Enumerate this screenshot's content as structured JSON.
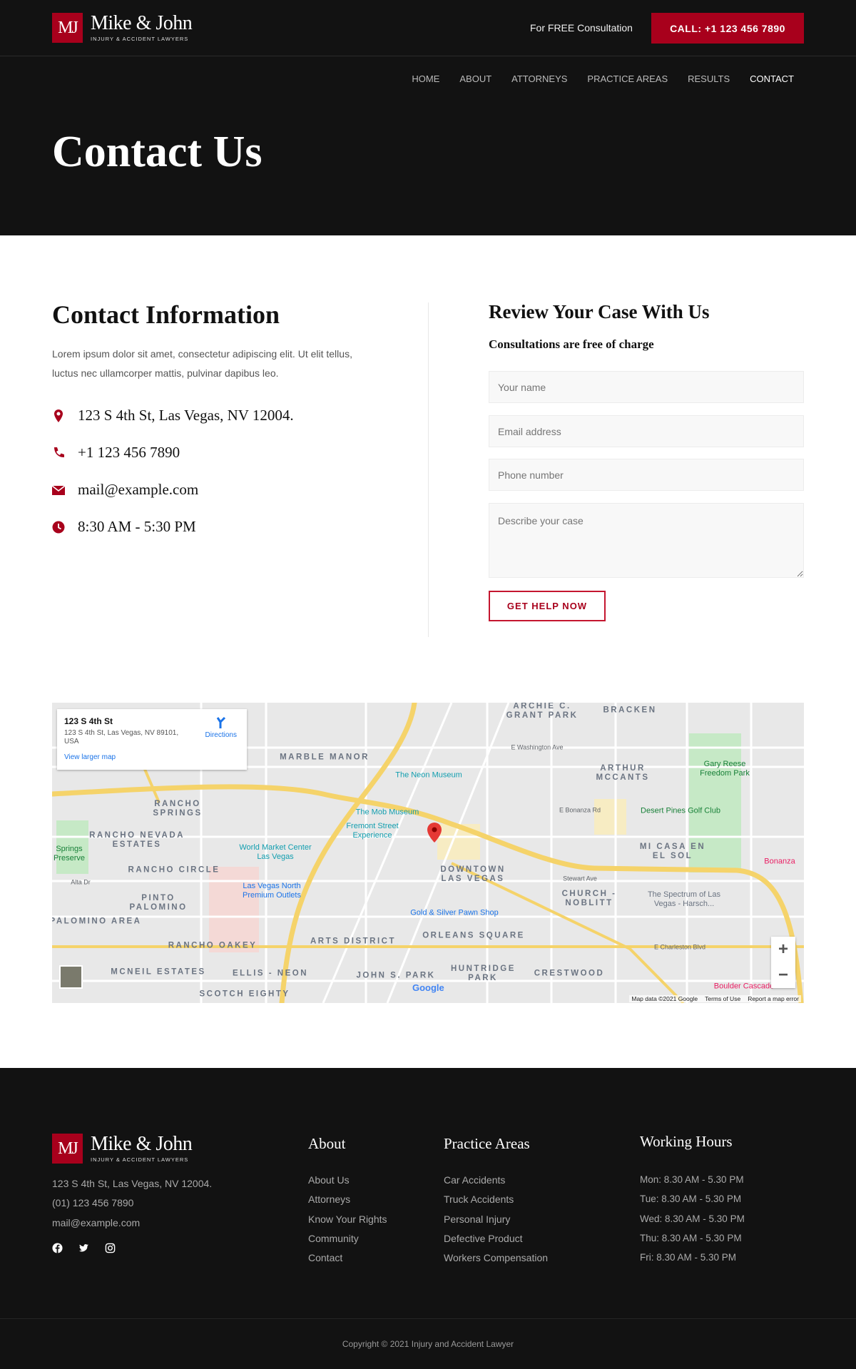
{
  "brand": {
    "mark": "MJ",
    "name": "Mike & John",
    "tagline": "INJURY & ACCIDENT LAWYERS",
    "accent": "#a8001c"
  },
  "header": {
    "free_text": "For FREE Consultation",
    "call_label": "CALL: +1 123 456 7890"
  },
  "nav": {
    "items": [
      {
        "label": "HOME"
      },
      {
        "label": "ABOUT"
      },
      {
        "label": "ATTORNEYS"
      },
      {
        "label": "PRACTICE AREAS"
      },
      {
        "label": "RESULTS"
      },
      {
        "label": "CONTACT",
        "active": true
      }
    ]
  },
  "hero": {
    "title": "Contact Us"
  },
  "contact": {
    "title": "Contact Information",
    "description": "Lorem ipsum dolor sit amet, consectetur adipiscing elit. Ut elit tellus, luctus nec ullamcorper mattis, pulvinar dapibus leo.",
    "items": [
      {
        "icon": "map-marker-icon",
        "text": "123 S 4th St, Las Vegas, NV 12004."
      },
      {
        "icon": "phone-icon",
        "text": "+1 123 456 7890"
      },
      {
        "icon": "envelope-icon",
        "text": "mail@example.com"
      },
      {
        "icon": "clock-icon",
        "text": "8:30 AM - 5:30 PM"
      }
    ]
  },
  "form": {
    "title": "Review Your Case With Us",
    "subtitle": "Consultations are free of charge",
    "name_placeholder": "Your name",
    "email_placeholder": "Email address",
    "phone_placeholder": "Phone number",
    "case_placeholder": "Describe your case",
    "submit_label": "GET HELP NOW"
  },
  "map": {
    "card": {
      "title": "123 S 4th St",
      "address": "123 S 4th St, Las Vegas, NV 89101, USA",
      "directions": "Directions",
      "larger": "View larger map"
    },
    "labels": [
      "ARCHIE C. GRANT PARK",
      "BRACKEN",
      "MARBLE MANOR",
      "The Neon Museum",
      "ARTHUR MCCANTS",
      "Gary Reese Freedom Park",
      "RANCHO SPRINGS",
      "The Mob Museum",
      "Fremont Street Experience",
      "Desert Pines Golf Club",
      "RANCHO NEVADA ESTATES",
      "Springs Preserve",
      "World Market Center Las Vegas",
      "MI CASA EN EL SOL",
      "RANCHO CIRCLE",
      "DOWNTOWN LAS VEGAS",
      "Las Vegas North Premium Outlets",
      "CHURCH - NOBLITT",
      "The Spectrum of Las Vegas - Harsch...",
      "PINTO PALOMINO",
      "PALOMINO AREA",
      "Gold & Silver Pawn Shop",
      "ARTS DISTRICT",
      "ORLEANS SQUARE",
      "RANCHO OAKEY",
      "MCNEIL ESTATES",
      "ELLIS - NEON",
      "JOHN S. PARK",
      "HUNTRIDGE PARK",
      "CRESTWOOD",
      "SCOTCH EIGHTY",
      "Boulder Cascade",
      "Bonanza",
      "E Washington Ave",
      "E Bonanza Rd",
      "Stewart Ave",
      "E Charleston Blvd",
      "Alta Dr"
    ],
    "zoom_in": "+",
    "zoom_out": "−",
    "google": "Google",
    "attribution": [
      "Map data ©2021 Google",
      "Terms of Use",
      "Report a map error"
    ]
  },
  "footer": {
    "address": "123 S 4th St, Las Vegas, NV 12004.",
    "phone": "(01) 123 456 7890",
    "email": "mail@example.com",
    "social": [
      "facebook-icon",
      "twitter-icon",
      "instagram-icon"
    ],
    "about": {
      "title": "About",
      "links": [
        "About Us",
        "Attorneys",
        "Know Your Rights",
        "Community",
        "Contact"
      ]
    },
    "practice": {
      "title": "Practice Areas",
      "links": [
        "Car Accidents",
        "Truck Accidents",
        "Personal Injury",
        "Defective Product",
        "Workers Compensation"
      ]
    },
    "hours": {
      "title": "Working Hours",
      "lines": [
        "Mon: 8.30 AM - 5.30 PM",
        "Tue: 8.30 AM - 5.30 PM",
        "Wed: 8.30 AM - 5.30 PM",
        "Thu: 8.30 AM - 5.30 PM",
        "Fri: 8.30 AM - 5.30 PM"
      ]
    },
    "copyright": "Copyright © 2021 Injury and Accident Lawyer"
  }
}
